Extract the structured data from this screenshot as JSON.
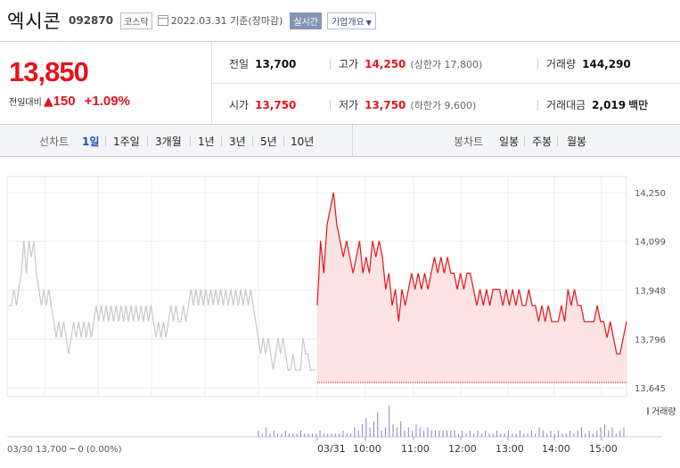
{
  "header": {
    "stock_name": "엑시콘",
    "stock_code": "092870",
    "market": "코스닥",
    "date_text": "2022.03.31 기준(장마감)",
    "realtime_label": "실시간",
    "company_button": "기업개요"
  },
  "price": {
    "current": "13,850",
    "change_label": "전일대비",
    "change_value": "150",
    "change_rate": "+1.09%"
  },
  "info": {
    "prev_close": {
      "label": "전일",
      "value": "13,700"
    },
    "high": {
      "label": "고가",
      "value": "14,250",
      "sub": "(상한가 17,800)"
    },
    "volume": {
      "label": "거래량",
      "value": "144,290"
    },
    "open": {
      "label": "시가",
      "value": "13,750"
    },
    "low": {
      "label": "저가",
      "value": "13,750",
      "sub": "(하한가 9,600)"
    },
    "amount": {
      "label": "거래대금",
      "value": "2,019",
      "unit": "백만"
    }
  },
  "period_bar": {
    "line_label": "선차트",
    "line_options": [
      "1일",
      "1주일",
      "3개월",
      "1년",
      "3년",
      "5년",
      "10년"
    ],
    "active_option": "1일",
    "candle_label": "봉차트",
    "candle_options": [
      "일봉",
      "주봉",
      "월봉"
    ]
  },
  "chart_data": {
    "type": "line",
    "y_ticks": [
      "14,250",
      "14,099",
      "13,948",
      "13,796",
      "13,645"
    ],
    "ylim": [
      13645,
      14250
    ],
    "x_labels": [
      "03/30",
      "03/31",
      "10:00",
      "11:00",
      "12:00",
      "13:00",
      "14:00",
      "15:00"
    ],
    "prev_day_label": "03/30  13,700 ─ 0 (0.00%)",
    "volume_legend": "거래량",
    "prev_close": 13700,
    "colors": {
      "up": "#e5121d",
      "fill": "#fde4e4",
      "prev": "#c8c8c8",
      "volume": "#8a7fc4"
    },
    "prev_day_series": [
      13900,
      13900,
      13950,
      13900,
      13950,
      14000,
      14100,
      14000,
      14100,
      14050,
      14100,
      14000,
      13950,
      13900,
      13950,
      13900,
      13950,
      13900,
      13850,
      13800,
      13850,
      13800,
      13850,
      13800,
      13750,
      13800,
      13850,
      13800,
      13850,
      13800,
      13850,
      13800,
      13850,
      13800,
      13850,
      13900,
      13850,
      13900,
      13850,
      13900,
      13850,
      13900,
      13850,
      13900,
      13850,
      13900,
      13850,
      13900,
      13850,
      13900,
      13850,
      13900,
      13850,
      13900,
      13850,
      13900,
      13850,
      13900,
      13850,
      13800,
      13850,
      13800,
      13850,
      13800,
      13850,
      13900,
      13850,
      13900,
      13850,
      13850,
      13900,
      13850,
      13900,
      13950,
      13900,
      13950,
      13900,
      13950,
      13900,
      13950,
      13900,
      13950,
      13900,
      13950,
      13900,
      13950,
      13900,
      13950,
      13900,
      13950,
      13900,
      13950,
      13900,
      13950,
      13900,
      13950,
      13900,
      13950,
      13900,
      13850,
      13800,
      13750,
      13800,
      13750,
      13800,
      13750,
      13700,
      13750,
      13800,
      13750,
      13800,
      13750,
      13700,
      13700,
      13750,
      13700,
      13700,
      13700,
      13800,
      13750,
      13750,
      13700,
      13700,
      13700
    ],
    "today_series": [
      13900,
      14100,
      14000,
      14150,
      14200,
      14250,
      14150,
      14100,
      14050,
      14100,
      14050,
      14000,
      14050,
      14100,
      14000,
      14050,
      14000,
      14100,
      14050,
      14100,
      14050,
      13950,
      14000,
      13900,
      13950,
      13850,
      13950,
      13900,
      13950,
      14000,
      13950,
      14000,
      13950,
      14000,
      13950,
      14000,
      14050,
      14000,
      14050,
      14000,
      14050,
      14000,
      14000,
      13950,
      14000,
      13950,
      14000,
      14000,
      13950,
      13900,
      13950,
      13900,
      13950,
      13900,
      13950,
      13950,
      13950,
      13900,
      13950,
      13900,
      13950,
      13900,
      13950,
      13900,
      13900,
      13950,
      13900,
      13900,
      13850,
      13900,
      13850,
      13900,
      13850,
      13850,
      13850,
      13900,
      13850,
      13950,
      13900,
      13950,
      13900,
      13900,
      13850,
      13850,
      13850,
      13850,
      13900,
      13850,
      13850,
      13800,
      13850,
      13800,
      13750,
      13750,
      13800,
      13850
    ],
    "volume_bars": [
      2,
      1,
      3,
      1,
      2,
      1,
      1,
      2,
      1,
      1,
      1,
      2,
      1,
      1,
      1,
      1,
      2,
      1,
      1,
      1,
      1,
      1,
      2,
      1,
      1,
      3,
      2,
      4,
      6,
      3,
      5,
      8,
      2,
      3,
      10,
      4,
      3,
      5,
      2,
      3,
      2,
      4,
      3,
      2,
      3,
      2,
      2,
      2,
      2,
      2,
      2,
      2,
      1,
      2,
      1,
      2,
      1,
      2,
      1,
      2,
      1,
      1,
      2,
      1,
      1,
      2,
      1,
      1,
      2,
      1,
      1,
      2,
      1,
      3,
      2,
      1,
      2,
      1,
      2,
      1,
      1,
      2,
      1,
      2,
      3,
      1,
      2,
      1,
      2,
      3,
      4,
      2,
      3,
      1,
      2,
      3
    ]
  }
}
